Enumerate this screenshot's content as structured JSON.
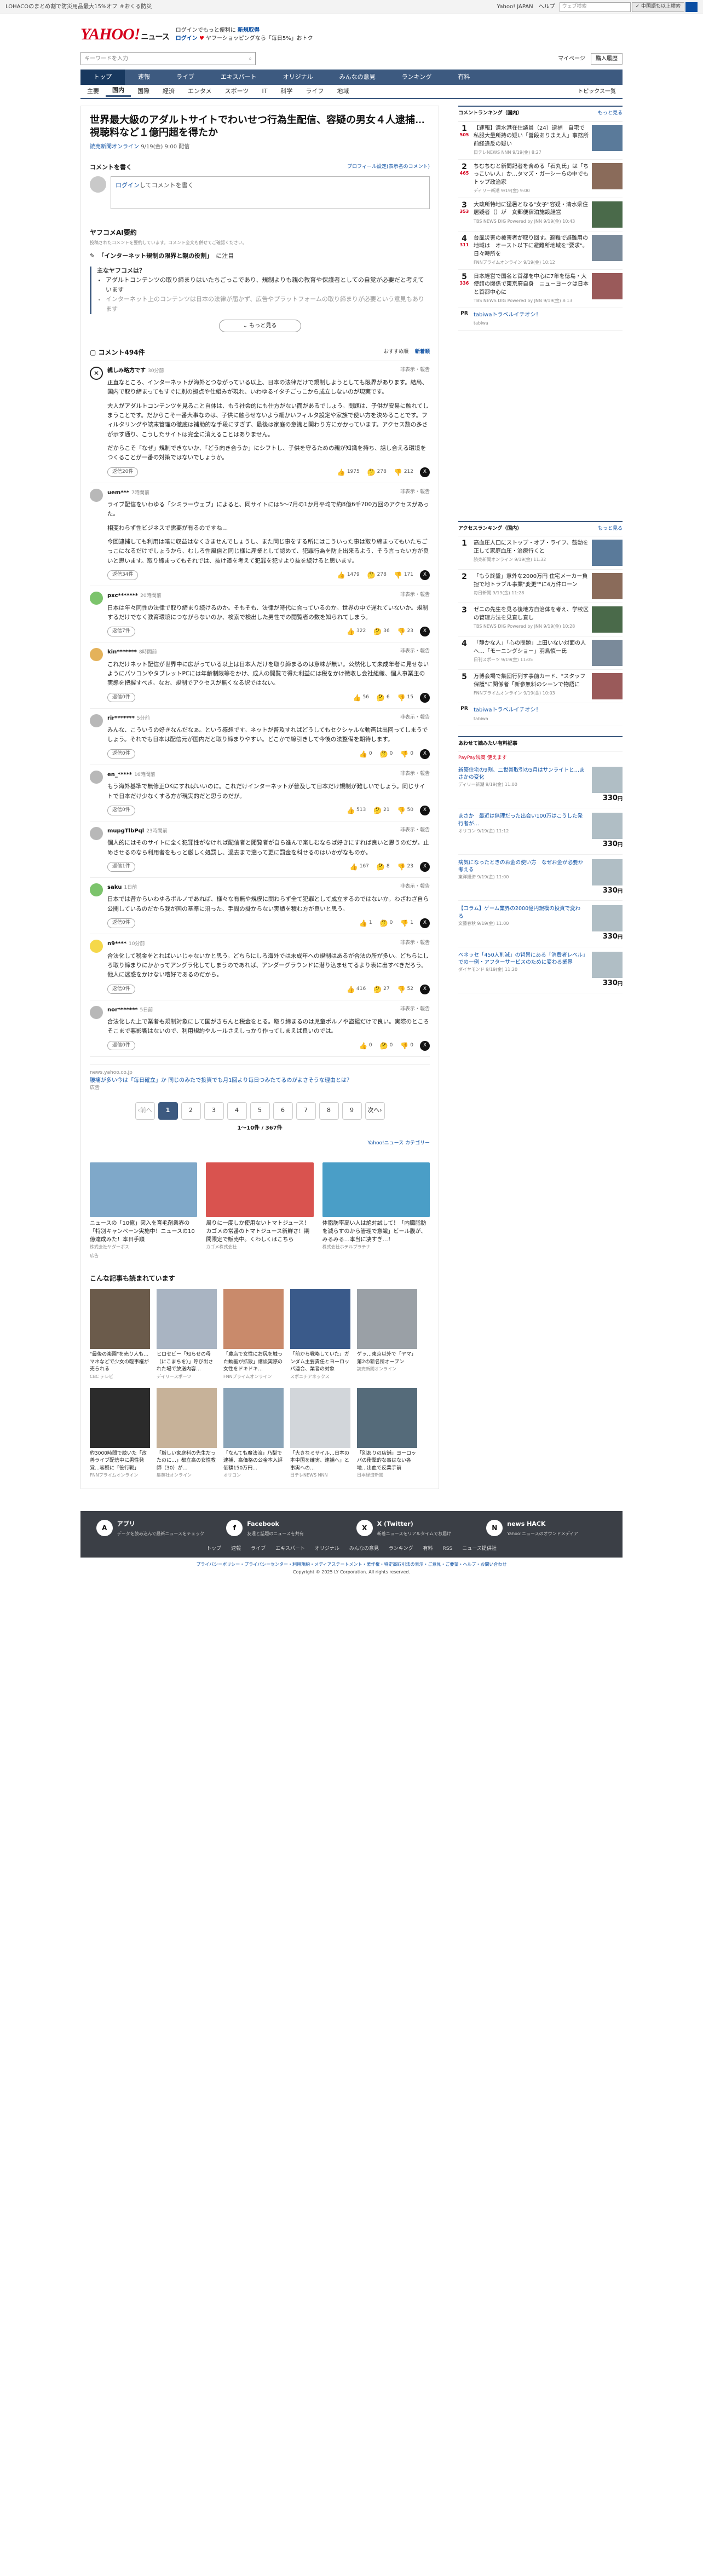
{
  "topbar": {
    "promo": "LOHACOのまとめ割で防災用品最大15%オフ ＃おくる防災",
    "links": [
      "Yahoo! JAPAN",
      "ヘルプ"
    ],
    "search_placeholder": "ウェブ検索",
    "mode": "✓ 中国語も以上検索"
  },
  "header": {
    "brand": "YAHOO!",
    "brand_sub": "JAPAN",
    "service": "ニュース",
    "line1": "ログインでもっと便利に",
    "line1_b": "新規取得",
    "line2a": "ログイン",
    "line2b": "ヤフーショッピングなら「毎日5%」おトク"
  },
  "search": {
    "placeholder": "キーワードを入力",
    "links": [
      "マイページ",
      "購入履歴"
    ]
  },
  "gnav": [
    "トップ",
    "速報",
    "ライブ",
    "エキスパート",
    "オリジナル",
    "みんなの意見",
    "ランキング",
    "有料"
  ],
  "snav": [
    "主要",
    "国内",
    "国際",
    "経済",
    "エンタメ",
    "スポーツ",
    "IT",
    "科学",
    "ライフ",
    "地域"
  ],
  "snav_right": "トピックス一覧",
  "article": {
    "title": "世界最大級のアダルトサイトでわいせつ行為生配信、容疑の男女４人逮捕…視聴料など１億円超を得たか",
    "source": "読売新聞オンライン",
    "date": "9/19(金) 9:00 配信"
  },
  "comment_form": {
    "head": "コメントを書く",
    "link": "プロフィール設定(表示名のコメント)",
    "placeholder_link": "ログイン",
    "placeholder": "してコメントを書く"
  },
  "ai": {
    "head": "ヤフコメAI要約",
    "note": "投稿されたコメントを要約しています。コメント全文も併せてご確認ください。",
    "topic_a": "「インターネット規制の限界と親の役割」",
    "topic_b": "に注目",
    "q": "主なヤフコメは？",
    "points": [
      "アダルトコンテンツの取り締まりはいたちごっこであり、規制よりも親の教育や保護者としての自覚が必要だと考えています",
      "インターネット上のコンテンツは日本の法律が届かず、広告やプラットフォームの取り締まりが必要という意見もあります"
    ],
    "more": "もっと見る"
  },
  "comments_head": {
    "title": "コメント494件",
    "sort1": "おすすめ順",
    "sort2": "新着順"
  },
  "comments": [
    {
      "user": "親しみ略方です",
      "badge": "30分前",
      "meta": "非表示・報告",
      "text": [
        "正直なところ、インターネットが海外とつながっている以上、日本の法律だけで規制しようとしても限界があります。結局、国内で取り締まってもすぐに別の拠点や仕組みが現れ、いわゆるイタチごっこから成立しないのが現実です。",
        "大人がアダルトコンテンツを見ること自体は、もう社会的にも仕方がない面があるでしょう。問題は、子供が安易に触れてしまうことです。だからこそ一番大事なのは、子供に触らせないよう細かいフィルタ設定や家族で使い方を決めることです。フィルタリングや端末管理の徹底は補助的な手段にすぎず、最後は家庭の意識と関わり方にかかっています。アクセス数の多さが示す通り、こうしたサイトは完全に消えることはありません。",
        "だからこそ「なぜ」規制できないか、「どう向き合うか」にシフトし、子供を守るための親が知識を持ち、話し合える環境をつくることが一番の対策ではないでしょうか。"
      ],
      "reply": "返信20件",
      "likes": "1975",
      "unsure": "278",
      "dislike": "212",
      "av": "x"
    },
    {
      "user": "uem***",
      "badge": "7時間前",
      "meta": "非表示・報告",
      "text": [
        "ライブ配信をいわゆる「シミラーウェブ」によると、同サイトには5～7月の1か月平均で約8億6千700万回のアクセスがあった。",
        "相変わらず性ビジネスで需要が有るのですね…",
        "今回逮捕しても利用は暗に収益はなくきませんでしょうし、また同じ事をする所にはこういった事は取り締まってもいたちごっこになるだけでしょうから、むしろ性風俗と同じ様に産業として認めて、犯罪行為を防止出来るよう、そう言ったい方が良いと思います。取り締まってもそれでは、抜け道を考えて犯罪を犯すより抜を続けると思います。"
      ],
      "reply": "返信34件",
      "likes": "1479",
      "unsure": "278",
      "dislike": "171",
      "av": "gr"
    },
    {
      "user": "pxc*******",
      "badge": "20時間前",
      "meta": "非表示・報告",
      "text": [
        "日本は年々同性の法律で取り締まり続けるのか。そもそも、法律が時代に合っているのか。世界の中で遅れていないか。規制するだけでなく教育環境につながらないのか、検索で検出した男性での閲覧者の数を知られてしまう。"
      ],
      "reply": "返信7件",
      "likes": "322",
      "unsure": "36",
      "dislike": "23",
      "av": "g"
    },
    {
      "user": "kin*******",
      "badge": "8時間前",
      "meta": "非表示・報告",
      "text": [
        "これだけネット配信が世界中に広がっている以上は日本人だけを取り締まるのは意味が無い。公然化して未成年者に見せないようにパソコンやタブレットPCには年齢制限等をかけ、成人の閲覧で得た利益には税をかけ徴収し会社組織、個人事業主の実態を把握すべき。なお、規制でアクセスが無くなる訳ではない。"
      ],
      "reply": "返信0件",
      "likes": "56",
      "unsure": "6",
      "dislike": "15",
      "av": "o"
    },
    {
      "user": "rir*******",
      "badge": "5分前",
      "meta": "非表示・報告",
      "text": [
        "みんな、こういうの好きなんだなぁ。という感想です。ネットが普及すればどうしてもセクシャルな動画は出回ってしまうでしょう。それでも日本は配信元が国内だと取り締まりやすい。どこかで線引きして今後の法整備を期待します。"
      ],
      "reply": "返信0件",
      "likes": "0",
      "unsure": "0",
      "dislike": "0",
      "av": "gr"
    },
    {
      "user": "en_*****",
      "badge": "16時間前",
      "meta": "非表示・報告",
      "text": [
        "もう海外基準で無修正OKにすればいいのに。これだけインターネットが普及して日本だけ規制が難しいでしょう。同じサイトで日本だけ少なくする方が現実的だと思うのだが。"
      ],
      "reply": "返信0件",
      "likes": "513",
      "unsure": "21",
      "dislike": "50",
      "av": "gr"
    },
    {
      "user": "mupgTlbPql",
      "badge": "23時間前",
      "meta": "非表示・報告",
      "text": [
        "個人的にはそのサイトに全く犯罪性がなければ配信者と閲覧者が自ら進んで楽しむならば好きにすれば良いと思うのだが。止めさせるのなら利用者をもっと厳しく処罰し、過去まで遡って更に罰金を科せるのはいかがなものか。"
      ],
      "reply": "返信1件",
      "likes": "167",
      "unsure": "8",
      "dislike": "23",
      "av": "gr"
    },
    {
      "user": "saku",
      "badge": "1日前",
      "meta": "非表示・報告",
      "text": [
        "日本では昔からいわゆるポルノであれば、様々な有無や規模に関わらず全て犯罪として成立するのではないか。わざわざ自ら公開しているのだから我が国の基準に沿った、手間の掛からない実績を積む方が良いと思う。"
      ],
      "reply": "返信0件",
      "likes": "1",
      "unsure": "0",
      "dislike": "1",
      "av": "g"
    },
    {
      "user": "n9****",
      "badge": "10分前",
      "meta": "非表示・報告",
      "text": [
        "合法化して税金をとればいいじゃないかと思う。どちらにしろ海外では未成年への規制はあるが合法の所が多い。どちらにしろ取り締まりにかかってアングラ化してしまうのであれば、アンダーグラウンドに潜り込ませてるより表に出すべきだろう。他人に迷惑をかけない嗜好であるのだから。"
      ],
      "reply": "返信0件",
      "likes": "416",
      "unsure": "27",
      "dislike": "52",
      "av": "y"
    },
    {
      "user": "nor*******",
      "badge": "5日前",
      "meta": "非表示・報告",
      "text": [
        "合法化した上で業者も規制対象にして国がきちんと税金をとる。取り締まるのは児童ポルノや盗撮だけで良い。実際のところそこまで悪影響はないので、利用規約やルールさえしっかり作ってしまえば良いのでは。"
      ],
      "reply": "返信0件",
      "likes": "0",
      "unsure": "0",
      "dislike": "0",
      "av": "gr"
    }
  ],
  "adline": {
    "src": "news.yahoo.co.jp",
    "text": "腰痛が多い今は「毎日確立」か 同じのみたで投資でも月1回より毎日つみたてるのがよさそうな理由とは？",
    "label": "広告"
  },
  "pager": {
    "prev": "前へ",
    "pages": [
      "1",
      "2",
      "3",
      "4",
      "5",
      "6",
      "7",
      "8",
      "9"
    ],
    "next": "次へ",
    "count": "1〜10件 / 367件"
  },
  "ad_category": "Yahoo!ニュース カテゴリー",
  "adcards": [
    {
      "t": "ニュースの「10億」突入を育毛剤業界の「特別キャンペーン実施中！ニュースの10億達成みた！本日手順",
      "s": "株式会社ヤダーボス"
    },
    {
      "t": "周りに一度しか使用ないトマトジュース！カゴメの常番のトマトジュース新鮮さ！期間限定で販売中。くわしくはこちら",
      "s": "カゴメ株式会社"
    },
    {
      "t": "体脂肪率高い人は絶対試して！「内臓脂肪を減らすのから管理で意識」ビール腹が、みるみる…本当に凄すぎ…！",
      "s": "株式会社ホテルプラチナ"
    }
  ],
  "ad_label": "広告",
  "popular_head": "こんな記事も読まれています",
  "popular": [
    {
      "t": "\"最後の楽園\"を売り人も…マネなどで少女の臨事権が売られる",
      "s": "CBC テレビ"
    },
    {
      "t": "ヒロセビー「知らせの母（にこまちを）」呼び出された場で放送内容…",
      "s": "デイリースポーツ"
    },
    {
      "t": "「農店で女性にお尻を触った動画が拡散」講談実際の女性をドキドキ…",
      "s": "FNNプライムオンライン"
    },
    {
      "t": "「前から戦略していた」ガンダム主要責任とヨーロッパ連合、業者の対象",
      "s": "スポニチアネックス"
    },
    {
      "t": "ゲッ…東京以外で「ヤマ」第2の新名所オーブン",
      "s": "読売新聞オンライン"
    },
    {
      "t": "約3000時間で続いた「改善ライブ配信中に男性発覚…容疑に「役行戦」",
      "s": "FNNプライムオンライン"
    },
    {
      "t": "「厳しい家庭科の先生だったのに…」都立高の女性教師（30）が…",
      "s": "集英社オンライン"
    },
    {
      "t": "「なんても魔法流」乃梨で逮捕、高価格の公金本入評価額150万円…",
      "s": "オリコン"
    },
    {
      "t": "「大きなミサイル…日本の本中国を確実、逮捕へ」と事実への…",
      "s": "日テレNEWS NNN"
    },
    {
      "t": "「別ありの店舗」ヨーロッパの衝撃的な事はない各地…出血で反業手前",
      "s": "日本経済新聞"
    }
  ],
  "rank_comment": {
    "head": "コメントランキング（国内）",
    "link": "もっと見る",
    "items": [
      {
        "n": "1",
        "c": "505",
        "t": "【速報】清水港在住議員（24）逮捕　自宅で私服大量所持の疑い「普段ありまえ人」事務所前経違反の疑い",
        "m": "日テレNEWS NNN 9/19(金) 8:27"
      },
      {
        "n": "2",
        "c": "465",
        "t": "ちむちむと新聞記者を含める「石丸氏」は「ちっこいい人」か…タマズ・ガーシーらの中でもトップ政治家",
        "m": "ディリー新潮 9/19(金) 9:00"
      },
      {
        "n": "3",
        "c": "353",
        "t": "大政所特地に猛暑となる\"女子\"容疑・清水県住居疑者（）が　女郵便宿泊施設経営",
        "m": "TBS NEWS DIG Powered by JNN 9/19(金) 10:43"
      },
      {
        "n": "4",
        "c": "311",
        "n2": "",
        "t": "台風災害の被害者が取り回す。避難で避難用の地域は　オースト以下に避難所地域を\"要求\"。日々時所を",
        "m": "FNNプライムオンライン 9/19(金) 10:12"
      },
      {
        "n": "5",
        "c": "336",
        "t": "日本経営で国名と首都を中心に7年を徳島・大使館の関係で東京府自身　ニューヨークは日本と首都中心に",
        "m": "TBS NEWS DIG Powered by JNN 9/19(金) 8:13"
      }
    ],
    "pr": "tabiwaトラベルイチオシ！",
    "pr_s": "tabiwa"
  },
  "rank_access": {
    "head": "アクセスランキング（国内）",
    "link": "もっと見る",
    "items": [
      {
        "n": "1",
        "t": "高血圧人口にストップ・オブ・ライフ、鼓動を正して家庭血圧・治療行くと",
        "m": "読売新聞オンライン 9/19(金) 11:32"
      },
      {
        "n": "2",
        "t": "「もう終盤」意外な2000万円 住宅メーカー負担で地トラブル事業\"変更\"\"に4万件ローン",
        "m": "毎日新聞 9/19(金) 11:28"
      },
      {
        "n": "3",
        "t": "ゼニの先生を見る後地方自治体を考え、学校区の管理方法を見直し直し",
        "m": "TBS NEWS DIG Powered by JNN 9/19(金) 10:28"
      },
      {
        "n": "4",
        "t": "「静かな人」「心の問題」上田いない対面の人へ…「モーニングショー」羽鳥慎一氏",
        "m": "日刊スポーツ 9/19(金) 11:05"
      },
      {
        "n": "5",
        "t": "万博会場で集団行列す事前カード、\"スタッフ保護\"に関係者「新参無料のシーンで物語に",
        "m": "FNNプライムオンライン 9/19(金) 10:03"
      }
    ],
    "pr": "tabiwaトラベルイチオシ！",
    "pr_s": "tabiwa"
  },
  "shop": {
    "head": "あわせて読みたい有料記事",
    "pp_label": "PayPay残高 使えます",
    "items": [
      {
        "t": "新築住宅の9割、二世帯取引の5月はサンライトと…まさかの変化",
        "m": "ディリー新潮 9/19(金) 11:00",
        "p": "330",
        "u": "円"
      },
      {
        "t": "まさか　最近は無理だった出会い100万はこうした発行者が…",
        "m": "オリコン 9/19(金) 11:12",
        "p": "330",
        "u": "円"
      },
      {
        "t": "病気になったときのお金の使い方　なぜお金が必要か考える",
        "m": "東洋経済 9/19(金) 11:00",
        "p": "330",
        "u": "円"
      },
      {
        "t": "【コラム】ゲーム業界の2000億円規模の投資で変わる",
        "m": "文藝春秋 9/19(金) 11:00",
        "p": "330",
        "u": "円"
      },
      {
        "t": "ベネッセ「450人削減」の背景にある「消費者レベル」での一例・アフターサービスのために変わる業界",
        "m": "ダイヤモンド 9/19(金) 11:20",
        "p": "330",
        "u": "円"
      }
    ]
  },
  "footer": {
    "cols": [
      {
        "icon": "A",
        "h": "アプリ",
        "s": "データを読み込んで最新ニュースをチェック"
      },
      {
        "icon": "f",
        "h": "Facebook",
        "s": "友達と話題のニュースを共有"
      },
      {
        "icon": "X",
        "h": "X (Twitter)",
        "s": "新着ニュースをリアルタイムでお届け"
      },
      {
        "icon": "N",
        "h": "news HACK",
        "s": "Yahoo!ニュースのオウンドメディア"
      }
    ],
    "links": [
      "トップ",
      "速報",
      "ライブ",
      "エキスパート",
      "オリジナル",
      "みんなの意見",
      "ランキング",
      "有料",
      "RSS",
      "ニュース提供社"
    ],
    "legal": "プライバシーポリシー・プライバシーセンター・利用規約・メディアステートメント・著作権・特定商取引法の表示・ご意見・ご要望・ヘルプ・お問い合わせ",
    "copy": "Copyright © 2025 LY Corporation. All rights reserved."
  },
  "colors": {
    "nav": "#3d5a80",
    "brand": "#d6001c",
    "link": "#0b4ea2"
  }
}
